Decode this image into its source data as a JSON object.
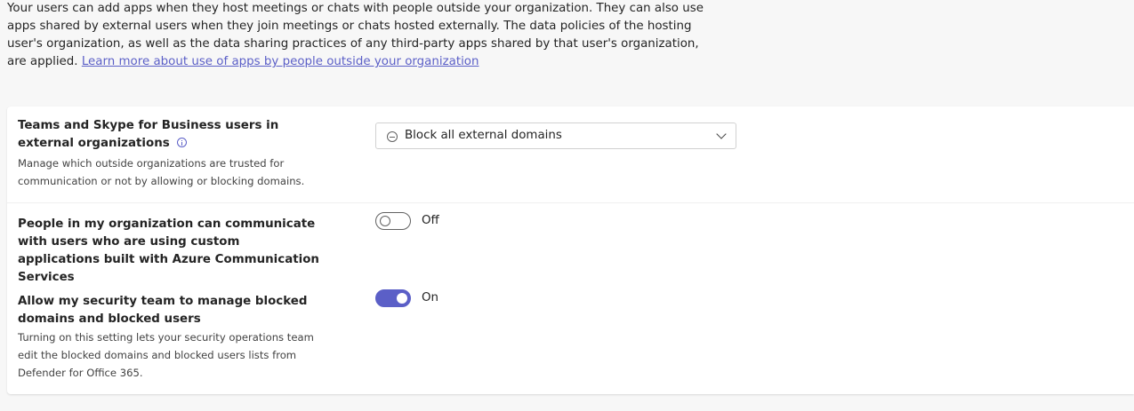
{
  "intro": {
    "text": "Your users can add apps when they host meetings or chats with people outside your organization. They can also use apps shared by external users when they join meetings or chats hosted externally. The data policies of the hosting user's organization, as well as the data sharing practices of any third-party apps shared by that user's organization, are applied.",
    "link_text": "Learn more about use of apps by people outside your organization"
  },
  "settings": {
    "external_orgs": {
      "title": "Teams and Skype for Business users in external organizations",
      "description": "Manage which outside organizations are trusted for communication or not by allowing or blocking domains.",
      "dropdown_value": "Block all external domains",
      "icon": "info-icon"
    },
    "acs": {
      "title": "People in my organization can communicate with users who are using custom applications built with Azure Communication Services",
      "toggle_state": "Off",
      "toggle_on": false
    },
    "security_team": {
      "title": "Allow my security team to manage blocked domains and blocked users",
      "description": "Turning on this setting lets your security operations team edit the blocked domains and blocked users lists from Defender for Office 365.",
      "toggle_state": "On",
      "toggle_on": true
    }
  },
  "colors": {
    "accent": "#5b5fc7",
    "background": "#f7f7f7",
    "card": "#ffffff"
  }
}
